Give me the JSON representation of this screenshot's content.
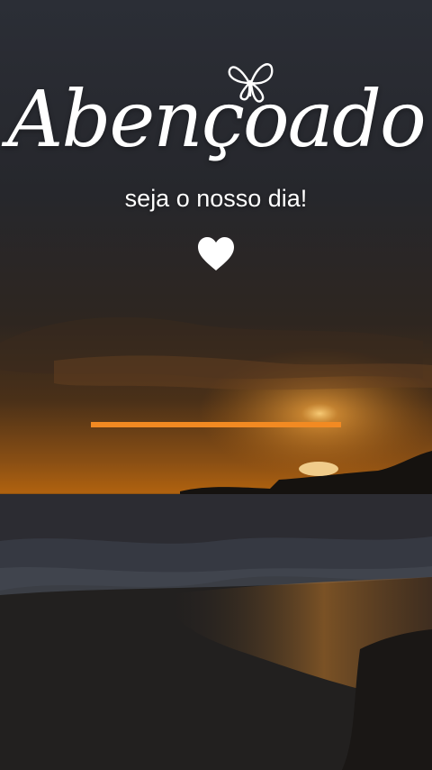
{
  "title": "Abençoado",
  "subtitle": "seja o nosso dia!",
  "progress": {
    "fraction": 1.0,
    "color": "#f28a22"
  },
  "icons": {
    "decoration": "butterfly-icon",
    "heart": "heart-icon"
  }
}
